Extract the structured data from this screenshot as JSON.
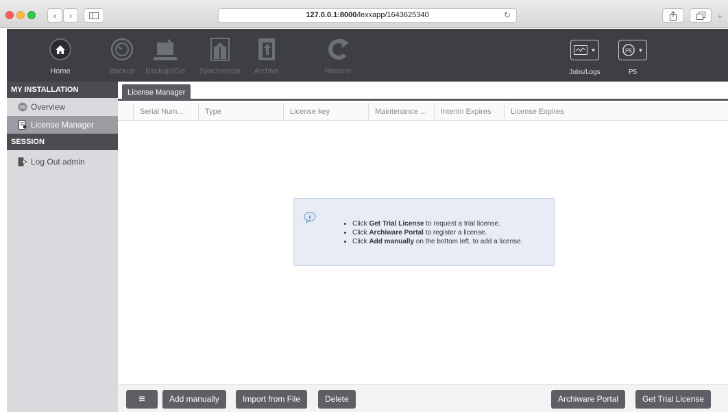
{
  "browser": {
    "url_host": "127.0.0.1:8000",
    "url_path": "/lexxapp/1643625340"
  },
  "toolbar": {
    "home": "Home",
    "backup": "Backup",
    "backup2go": "Backup2Go",
    "synchronize": "Synchronize",
    "archive": "Archive",
    "restore": "Restore",
    "jobs_logs": "Jobs/Logs",
    "p5": "P5"
  },
  "sidebar": {
    "installation_header": "MY INSTALLATION",
    "overview": "Overview",
    "license_manager": "License Manager",
    "session_header": "SESSION",
    "logout": "Log Out admin"
  },
  "main": {
    "tab": "License Manager",
    "columns": [
      "Serial Num...",
      "Type",
      "License key",
      "Maintenance ...",
      "Interim Expires",
      "License Expires"
    ],
    "info": {
      "line1_pre": "Click ",
      "line1_bold": "Get Trial License",
      "line1_post": " to request a trial license.",
      "line2_pre": "Click ",
      "line2_bold": "Archiware Portal",
      "line2_post": " to register a license.",
      "line3_pre": "Click ",
      "line3_bold": "Add manually",
      "line3_post": " on the bottom left, to add a license."
    }
  },
  "footer": {
    "menu": "≡",
    "add_manually": "Add manually",
    "import_from_file": "Import from File",
    "delete": "Delete",
    "archiware_portal": "Archiware Portal",
    "get_trial_license": "Get Trial License"
  },
  "colors": {
    "toolbar_bg": "#3d3f44",
    "sidebar_bg": "#d9dadd",
    "sidebar_active": "#9a9ca1",
    "button_bg": "#5d5f64",
    "info_bg": "#e8edf5"
  }
}
